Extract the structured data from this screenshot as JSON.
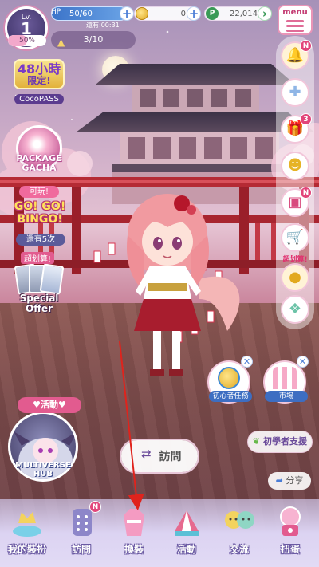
{
  "status": {
    "level_label": "Lv.",
    "level": "1",
    "level_progress_text": "50%",
    "level_progress": 0.5,
    "hp_label": "HP",
    "hp_value": "50/60",
    "hp_timer": "還有:00:31",
    "coins": "0",
    "gems": "22,014",
    "gem_symbol": "P",
    "flags": "3/10"
  },
  "menu": {
    "label": "menu"
  },
  "promos": {
    "cocopass": {
      "line1": "48小時",
      "line2": "限定!",
      "label": "CocoPASS"
    },
    "gacha": {
      "line1": "PACKAGE",
      "line2": "GACHA",
      "pill": "可玩!"
    },
    "bingo": {
      "line1": "GO! GO!",
      "line2": "BINGO!",
      "pill": "還有5次"
    },
    "special": {
      "tag": "超划算!",
      "line1": "Special",
      "line2": "Offer"
    }
  },
  "right_icons": {
    "notify_badge": "N",
    "gift_badge": "3",
    "present_badge": "N",
    "super_deal": "超划算!"
  },
  "widgets": {
    "task_label": "初心者任務",
    "market_label": "市場",
    "beginner_support": "初學者支援",
    "share": "分享",
    "visit": "訪問",
    "event_tag": "♥活動♥",
    "event_logo_1": "MULTIVERSE",
    "event_logo_2": "HUB"
  },
  "nav": {
    "wardrobe": "我的裝扮",
    "visit": "訪問",
    "visit_badge": "N",
    "dressup": "換裝",
    "event": "活動",
    "social": "交流",
    "gacha": "扭蛋"
  },
  "colors": {
    "accent": "#e25b8f",
    "nav_bg": "#dcd3f2",
    "arrow": "#e0231c"
  }
}
